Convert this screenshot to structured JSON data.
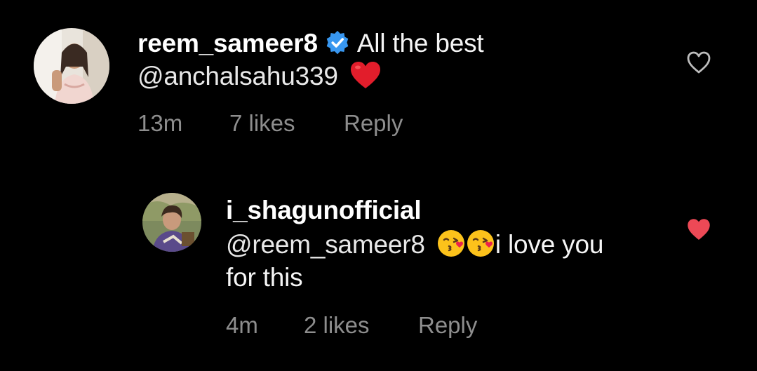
{
  "colors": {
    "background": "#000000",
    "text": "#ffffff",
    "meta": "#8e8e8e",
    "verified": "#3897f0",
    "liked": "#ed4956"
  },
  "comments": [
    {
      "username": "reem_sameer8",
      "verified": true,
      "text_line1": "All the best",
      "mention": "@anchalsahu339",
      "emoji": "red-heart-emoji",
      "time": "13m",
      "likes": "7 likes",
      "reply": "Reply",
      "liked": false,
      "like_icon": "heart-outline-icon"
    },
    {
      "username": "i_shagunofficial",
      "verified": false,
      "mention": "@reem_sameer8",
      "emoji": "kissing-heart-emoji",
      "text_after_emoji": "i love you",
      "text_line2": "for this",
      "time": "4m",
      "likes": "2 likes",
      "reply": "Reply",
      "liked": true,
      "like_icon": "heart-filled-icon"
    }
  ]
}
